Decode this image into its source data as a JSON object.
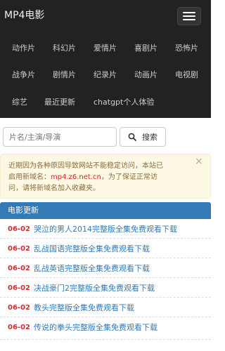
{
  "brand": "MP4电影",
  "nav": {
    "row1": [
      "动作片",
      "科幻片",
      "爱情片",
      "喜剧片",
      "恐怖片"
    ],
    "row2": [
      "战争片",
      "剧情片",
      "纪录片",
      "动画片",
      "电视剧"
    ],
    "row3": [
      "综艺",
      "最近更新",
      "chatgpt个人体验"
    ]
  },
  "search": {
    "placeholder": "片名/主演/导演",
    "button_label": "搜索"
  },
  "alert": {
    "line1": "近期因为各种原因导致网站不能稳定访问，本站已",
    "line2_prefix": "启用新域名：",
    "domain": "mp4.z6.net.cn",
    "line2_suffix": "，为了保证正常访",
    "line3": "问，请将新域名加入收藏夹。",
    "close": "×"
  },
  "latest": {
    "heading": "电影更新",
    "items": [
      {
        "date": "06-02",
        "title": "哭泣的男人2014完整版全集免费观看下载"
      },
      {
        "date": "06-02",
        "title": "乱战国语完整版全集免费观看下载"
      },
      {
        "date": "06-02",
        "title": "乱战英语完整版全集免费观看下载"
      },
      {
        "date": "06-02",
        "title": "决战豪门2完整版全集免费观看下载"
      },
      {
        "date": "06-02",
        "title": "教头完整版全集免费观看下载"
      },
      {
        "date": "06-02",
        "title": "传说的拳头完整版全集免费观看下载"
      }
    ]
  }
}
